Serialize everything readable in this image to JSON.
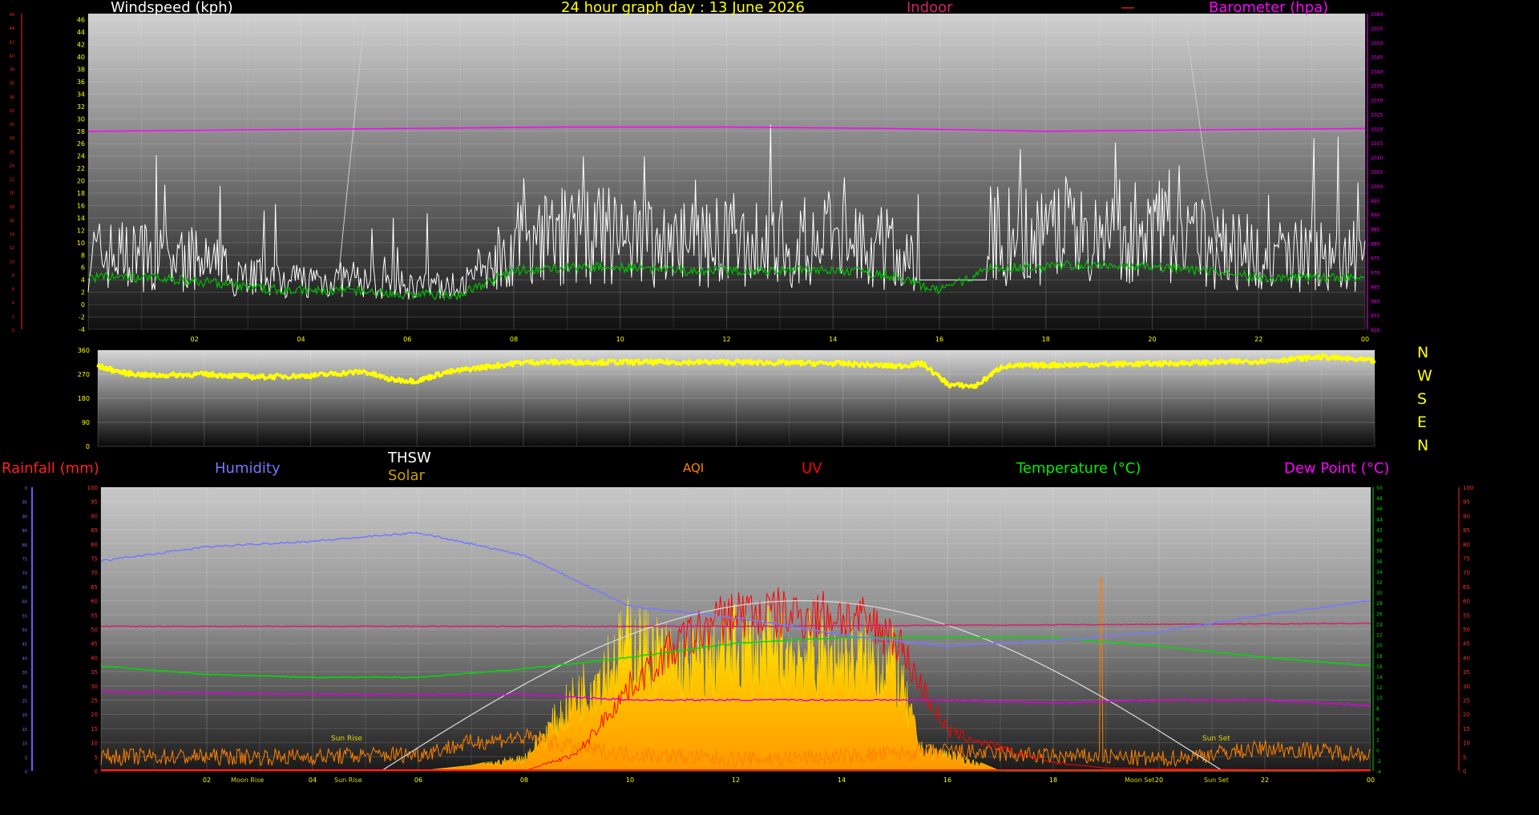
{
  "header": {
    "windspeed_label": "Windspeed (kph)",
    "title": "24 hour graph day : 13 June 2026",
    "indoor_label": "Indoor",
    "dash_label": "—",
    "barometer_label": "Barometer (hpa)"
  },
  "legend2": {
    "rainfall_label": "Rainfall (mm)",
    "humidity_label": "Humidity",
    "thsw_label": "THSW",
    "solar_label": "Solar",
    "aqi_label": "AQI",
    "uv_label": "UV",
    "temperature_label": "Temperature (°C)",
    "dewpoint_label": "Dew Point (°C)"
  },
  "compass": [
    "N",
    "W",
    "S",
    "E",
    "N"
  ],
  "colors": {
    "windspeed": "#ffffff",
    "gust": "#00c000",
    "barometer": "#ff00ff",
    "indoor": "#d4206a",
    "wind_direction": "#ffff00",
    "humidity": "#7777ff",
    "temperature": "#00dd00",
    "dewpoint": "#dd00dd",
    "uv": "#ff0000",
    "aqi": "#ff8000",
    "solar": "#ffcc00",
    "thsw": "#ffffff",
    "title": "#ffff00",
    "rainfall": "#ff0000"
  },
  "annotations": {
    "sunrise_top": "Sun Rise",
    "sunset_top": "Sun Set",
    "moonrise": "Moon Rise",
    "sunrise": "Sun Rise",
    "moonset": "Moon Set",
    "sunset": "Sun Set"
  },
  "chart_data": [
    {
      "type": "line",
      "title": "Windspeed (kph)",
      "x_ticks": [
        "02",
        "04",
        "06",
        "08",
        "10",
        "12",
        "14",
        "16",
        "18",
        "20",
        "22",
        "00"
      ],
      "y_left_ticks": [
        "-4",
        "-2",
        "0",
        "2",
        "4",
        "6",
        "8",
        "10",
        "12",
        "14",
        "16",
        "18",
        "20",
        "22",
        "24",
        "26",
        "28",
        "30",
        "32",
        "34",
        "36",
        "38",
        "40",
        "42",
        "44",
        "46"
      ],
      "ylim_left": [
        -4,
        47
      ],
      "y_right_ticks": [
        "950",
        "955",
        "960",
        "965",
        "970",
        "975",
        "980",
        "985",
        "990",
        "995",
        "1000",
        "1005",
        "1010",
        "1015",
        "1020",
        "1025",
        "1030",
        "1035",
        "1040",
        "1045",
        "1050",
        "1055",
        "1060"
      ],
      "ylim_right": [
        950,
        1060
      ],
      "series": [
        {
          "name": "Windspeed (kph)",
          "x": [
            0,
            1,
            2,
            3,
            4,
            5,
            6,
            7,
            8,
            9,
            10,
            11,
            12,
            13,
            14,
            15,
            16,
            17,
            18,
            19,
            20,
            21,
            22,
            23,
            24
          ],
          "values": [
            8,
            8,
            7,
            5,
            4,
            4,
            3,
            3,
            10,
            11,
            11,
            10,
            10,
            10,
            10,
            9,
            4,
            11,
            11,
            12,
            11,
            10,
            8,
            8,
            8
          ]
        },
        {
          "name": "Barometer (hpa)",
          "x": [
            0,
            3,
            6,
            9,
            12,
            15,
            18,
            21,
            24
          ],
          "values": [
            1019,
            1019.5,
            1020,
            1020.5,
            1020.5,
            1020,
            1019,
            1019.5,
            1020
          ]
        }
      ]
    },
    {
      "type": "scatter",
      "title": "Wind direction",
      "y_ticks": [
        "0",
        "90",
        "180",
        "270",
        "360"
      ],
      "ylim": [
        0,
        360
      ],
      "series": [
        {
          "name": "Wind direction",
          "x": [
            0,
            0.5,
            1,
            2,
            3,
            4,
            5,
            5.5,
            6,
            6.5,
            7,
            8,
            10,
            12,
            14,
            15,
            15.5,
            16,
            16.5,
            17,
            18,
            20,
            22,
            23,
            24
          ],
          "values": [
            300,
            275,
            265,
            270,
            260,
            265,
            280,
            250,
            245,
            275,
            290,
            315,
            315,
            315,
            310,
            300,
            310,
            230,
            225,
            300,
            305,
            310,
            320,
            335,
            320
          ]
        }
      ]
    },
    {
      "type": "line",
      "title": "",
      "x_ticks": [
        "02",
        "04",
        "06",
        "08",
        "10",
        "12",
        "14",
        "16",
        "18",
        "20",
        "22",
        "00"
      ],
      "y_left_ticks": [
        "0",
        "5",
        "10",
        "15",
        "20",
        "25",
        "30",
        "35",
        "40",
        "45",
        "50",
        "55",
        "60",
        "65",
        "70",
        "75",
        "80",
        "85",
        "90",
        "95",
        "100"
      ],
      "ylim_left": [
        0,
        100
      ],
      "y_green_ticks": [
        "-4",
        "-2",
        "0",
        "2",
        "4",
        "6",
        "8",
        "10",
        "12",
        "14",
        "16",
        "18",
        "20",
        "22",
        "24",
        "26",
        "28",
        "30",
        "32",
        "34",
        "36",
        "38",
        "40",
        "42",
        "44",
        "46",
        "48",
        "50"
      ],
      "ylim_green": [
        -4,
        50
      ],
      "series": [
        {
          "name": "Humidity",
          "x": [
            0,
            2,
            4,
            6,
            8,
            10,
            12,
            14,
            16,
            18,
            20,
            22,
            24
          ],
          "values": [
            74,
            79,
            81,
            84,
            76,
            58,
            54,
            48,
            44,
            46,
            49,
            55,
            60
          ]
        },
        {
          "name": "Temperature (°C)",
          "x": [
            0,
            2,
            4,
            6,
            8,
            10,
            12,
            14,
            16,
            18,
            20,
            22,
            24
          ],
          "values": [
            37,
            34,
            33,
            33,
            36,
            40,
            45,
            47,
            47,
            47,
            44,
            40,
            37
          ]
        },
        {
          "name": "Dew Point (°C)",
          "x": [
            0,
            4,
            8,
            10,
            12,
            14,
            16,
            18,
            20,
            22,
            24
          ],
          "values": [
            28,
            27,
            27,
            25,
            25,
            25,
            25,
            24,
            25,
            25,
            23
          ]
        },
        {
          "name": "Indoor",
          "x": [
            0,
            12,
            24
          ],
          "values": [
            51,
            51,
            52
          ]
        },
        {
          "name": "UV",
          "x": [
            0,
            8,
            9,
            10,
            11,
            12,
            13,
            14,
            15,
            15.5,
            16,
            17,
            18,
            19,
            24
          ],
          "values": [
            0,
            0,
            6,
            30,
            46,
            56,
            55,
            55,
            48,
            30,
            14,
            8,
            3,
            1,
            0
          ]
        },
        {
          "name": "Solar",
          "x": [
            0,
            6,
            7,
            8,
            9,
            10,
            11,
            12,
            13,
            14,
            15,
            15.5,
            16,
            17,
            24
          ],
          "values": [
            0,
            0,
            2,
            6,
            35,
            60,
            48,
            57,
            55,
            53,
            49,
            10,
            8,
            0,
            0
          ]
        },
        {
          "name": "AQI",
          "x": [
            0,
            4,
            6,
            7,
            8,
            9,
            10,
            12,
            14,
            16,
            18,
            19,
            20,
            22,
            24
          ],
          "values": [
            5,
            5,
            6,
            10,
            12,
            8,
            6,
            4,
            5,
            7,
            5,
            5,
            4,
            8,
            6
          ]
        }
      ]
    }
  ]
}
